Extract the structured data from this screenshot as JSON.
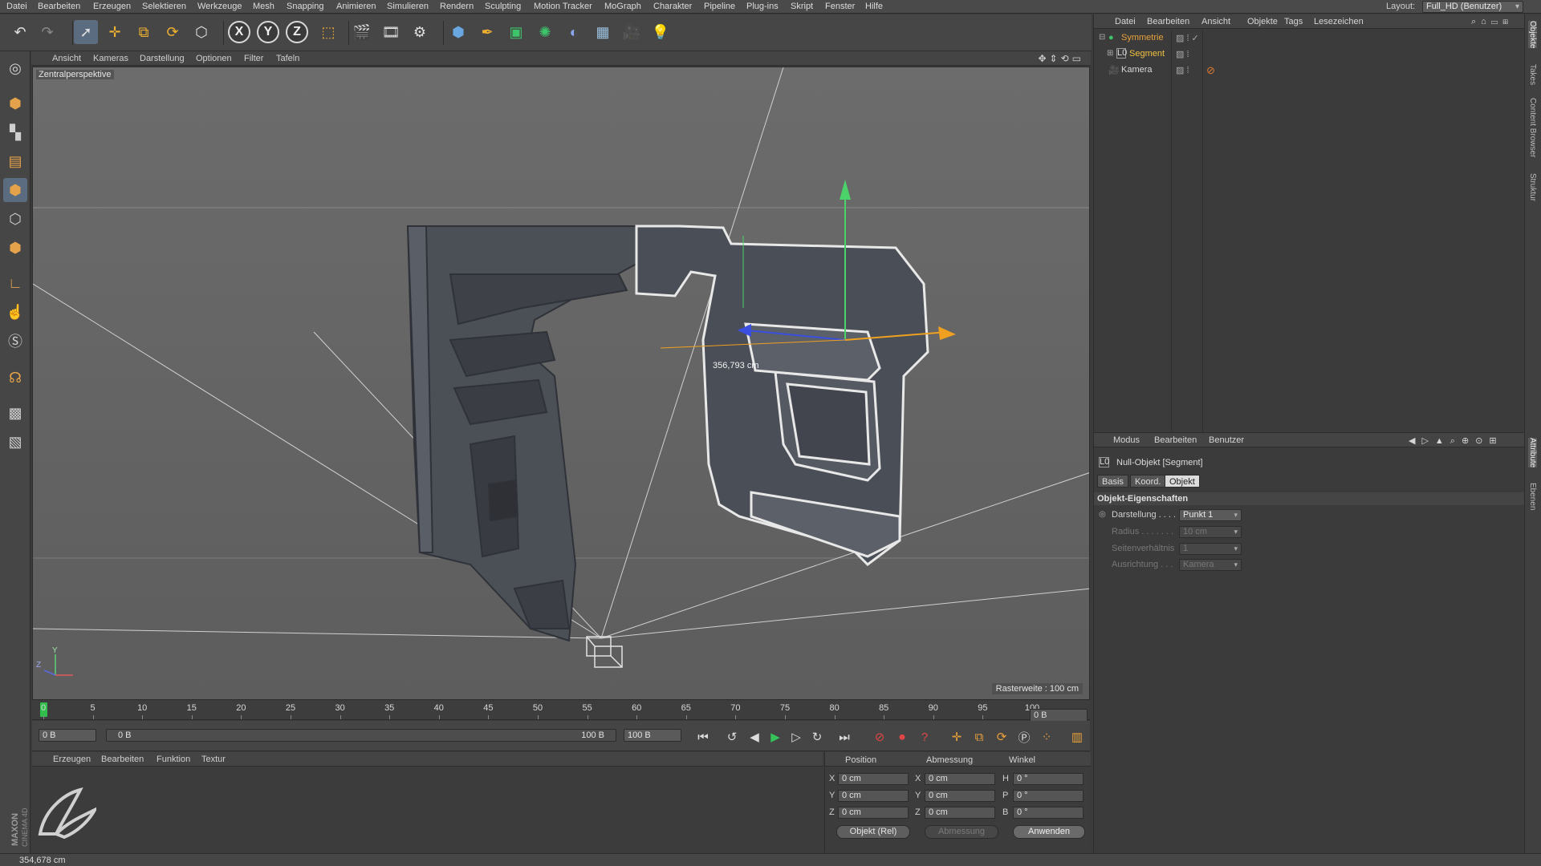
{
  "menu": [
    "Datei",
    "Bearbeiten",
    "Erzeugen",
    "Selektieren",
    "Werkzeuge",
    "Mesh",
    "Snapping",
    "Animieren",
    "Simulieren",
    "Rendern",
    "Sculpting",
    "Motion Tracker",
    "MoGraph",
    "Charakter",
    "Pipeline",
    "Plug-ins",
    "Skript",
    "Fenster",
    "Hilfe"
  ],
  "layout": {
    "label": "Layout:",
    "value": "Full_HD (Benutzer)"
  },
  "toolbar": {
    "icons": [
      "undo-icon",
      "redo-icon",
      "select-arrow-icon",
      "move-icon",
      "scale-icon",
      "rotate-icon",
      "last-tool-icon",
      "x-axis-icon",
      "y-axis-icon",
      "z-axis-icon",
      "coordinate-system-icon",
      "render-view-icon",
      "render-picture-viewer-icon",
      "render-settings-icon",
      "cube-icon",
      "pen-spline-icon",
      "subdivision-icon",
      "array-icon",
      "deformer-icon",
      "floor-icon",
      "camera-icon",
      "light-icon"
    ],
    "axes": [
      "X",
      "Y",
      "Z"
    ]
  },
  "viewport": {
    "menu": [
      "Ansicht",
      "Kameras",
      "Darstellung",
      "Optionen",
      "Filter",
      "Tafeln"
    ],
    "label": "Zentralperspektive",
    "measure": "356,793 cm",
    "raster": "Rasterweite : 100 cm",
    "axis_y": "Y",
    "axis_z": "Z"
  },
  "timeline": {
    "ticks": [
      "0",
      "5",
      "10",
      "15",
      "20",
      "25",
      "30",
      "35",
      "40",
      "45",
      "50",
      "55",
      "60",
      "65",
      "70",
      "75",
      "80",
      "85",
      "90",
      "95",
      "100"
    ],
    "right_field": "0 B",
    "start_field": "0 B",
    "range_start": "0 B",
    "range_end": "100 B",
    "end_field": "100 B"
  },
  "material_manager": {
    "menu": [
      "Erzeugen",
      "Bearbeiten",
      "Funktion",
      "Textur"
    ],
    "brand_top": "MAXON",
    "brand_bottom": "CINEMA 4D"
  },
  "coordinates": {
    "headers": [
      "Position",
      "Abmessung",
      "Winkel"
    ],
    "rows": [
      {
        "axis": "X",
        "pos": "0 cm",
        "size_axis": "X",
        "size": "0 cm",
        "rot_axis": "H",
        "rot": "0 °"
      },
      {
        "axis": "Y",
        "pos": "0 cm",
        "size_axis": "Y",
        "size": "0 cm",
        "rot_axis": "P",
        "rot": "0 °"
      },
      {
        "axis": "Z",
        "pos": "0 cm",
        "size_axis": "Z",
        "size": "0 cm",
        "rot_axis": "B",
        "rot": "0 °"
      }
    ],
    "mode": "Objekt (Rel)",
    "size_mode": "Abmessung",
    "apply": "Anwenden"
  },
  "object_manager": {
    "menu": [
      "Datei",
      "Bearbeiten",
      "Ansicht",
      "Objekte",
      "Tags",
      "Lesezeichen"
    ],
    "objects": [
      {
        "name": "Symmetrie",
        "color": "#e8a13a"
      },
      {
        "name": "Segment",
        "color": "#f0c040"
      },
      {
        "name": "Kamera",
        "color": "#d8d8d8"
      }
    ]
  },
  "attributes": {
    "menu": [
      "Modus",
      "Bearbeiten",
      "Benutzer"
    ],
    "object_title": "Null-Objekt [Segment]",
    "tabs": [
      "Basis",
      "Koord.",
      "Objekt"
    ],
    "active_tab": "Objekt",
    "section": "Objekt-Eigenschaften",
    "props": [
      {
        "label": "Darstellung . . . .",
        "value": "Punkt 1"
      },
      {
        "label": "Radius . . . . . . .",
        "value": "10 cm"
      },
      {
        "label": "Seitenverhältnis",
        "value": "1"
      },
      {
        "label": "Ausrichtung . . .",
        "value": "Kamera"
      }
    ]
  },
  "right_tabs": [
    "Objekte",
    "Takes",
    "Content Browser",
    "Struktur",
    "Attribute",
    "Ebenen"
  ],
  "status": "354,678 cm"
}
